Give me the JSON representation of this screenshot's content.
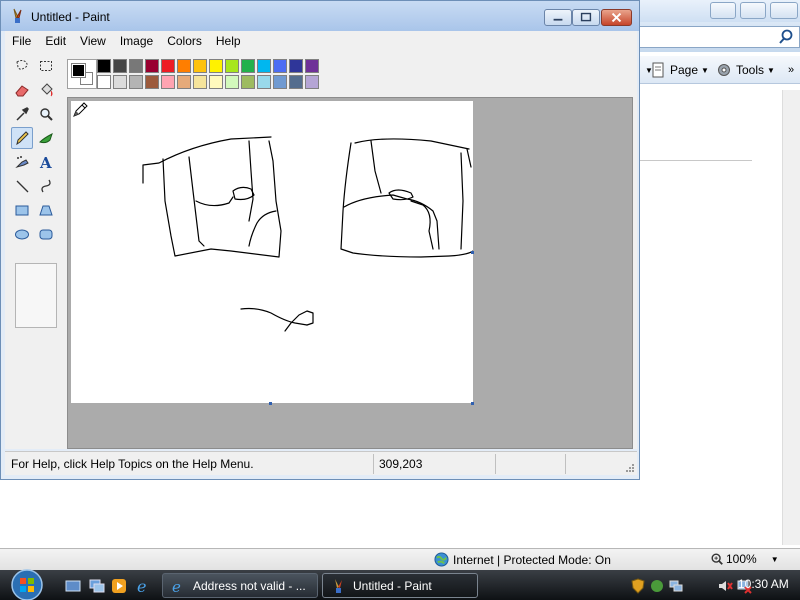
{
  "paint": {
    "title": "Untitled - Paint",
    "menu": [
      "File",
      "Edit",
      "View",
      "Image",
      "Colors",
      "Help"
    ],
    "palette_top": [
      "#000000",
      "#464646",
      "#787878",
      "#990030",
      "#ed1c24",
      "#ff7e00",
      "#ffc20e",
      "#fff200",
      "#a8e61d",
      "#22b14c",
      "#00b7ef",
      "#4d6df3",
      "#2f3699",
      "#6f3198"
    ],
    "palette_bottom": [
      "#ffffff",
      "#dcdcdc",
      "#b4b4b4",
      "#9c5a3c",
      "#ffa3b1",
      "#e5aa7a",
      "#f5e49c",
      "#fff9bd",
      "#d3f9bc",
      "#9dbb61",
      "#99d9ea",
      "#709ad1",
      "#546d8e",
      "#b5a5d5"
    ],
    "foreground_color": "#000000",
    "background_color": "#ffffff",
    "tools": [
      {
        "name": "free-form-select-icon"
      },
      {
        "name": "select-icon"
      },
      {
        "name": "eraser-icon"
      },
      {
        "name": "fill-icon"
      },
      {
        "name": "pick-color-icon"
      },
      {
        "name": "magnifier-icon"
      },
      {
        "name": "pencil-icon"
      },
      {
        "name": "brush-icon"
      },
      {
        "name": "airbrush-icon"
      },
      {
        "name": "text-icon",
        "glyph": "A"
      },
      {
        "name": "line-icon"
      },
      {
        "name": "curve-icon"
      },
      {
        "name": "rectangle-icon"
      },
      {
        "name": "polygon-icon"
      },
      {
        "name": "ellipse-icon"
      },
      {
        "name": "rounded-rectangle-icon"
      }
    ],
    "selected_tool": "pencil-icon",
    "status": {
      "help_text": "For Help, click Help Topics on the Help Menu.",
      "coordinates": "309,203"
    }
  },
  "ie": {
    "commands": [
      {
        "label": "Page",
        "icon": "page-icon"
      },
      {
        "label": "Tools",
        "icon": "gear-icon"
      }
    ],
    "status": {
      "zone": "Internet | Protected Mode: On",
      "zoom": "100%"
    }
  },
  "taskbar": {
    "tasks": [
      {
        "label": "Address not valid - ...",
        "icon": "ie-icon",
        "active": false
      },
      {
        "label": "Untitled - Paint",
        "icon": "paint-icon",
        "active": true
      }
    ],
    "clock": "10:30 AM"
  }
}
